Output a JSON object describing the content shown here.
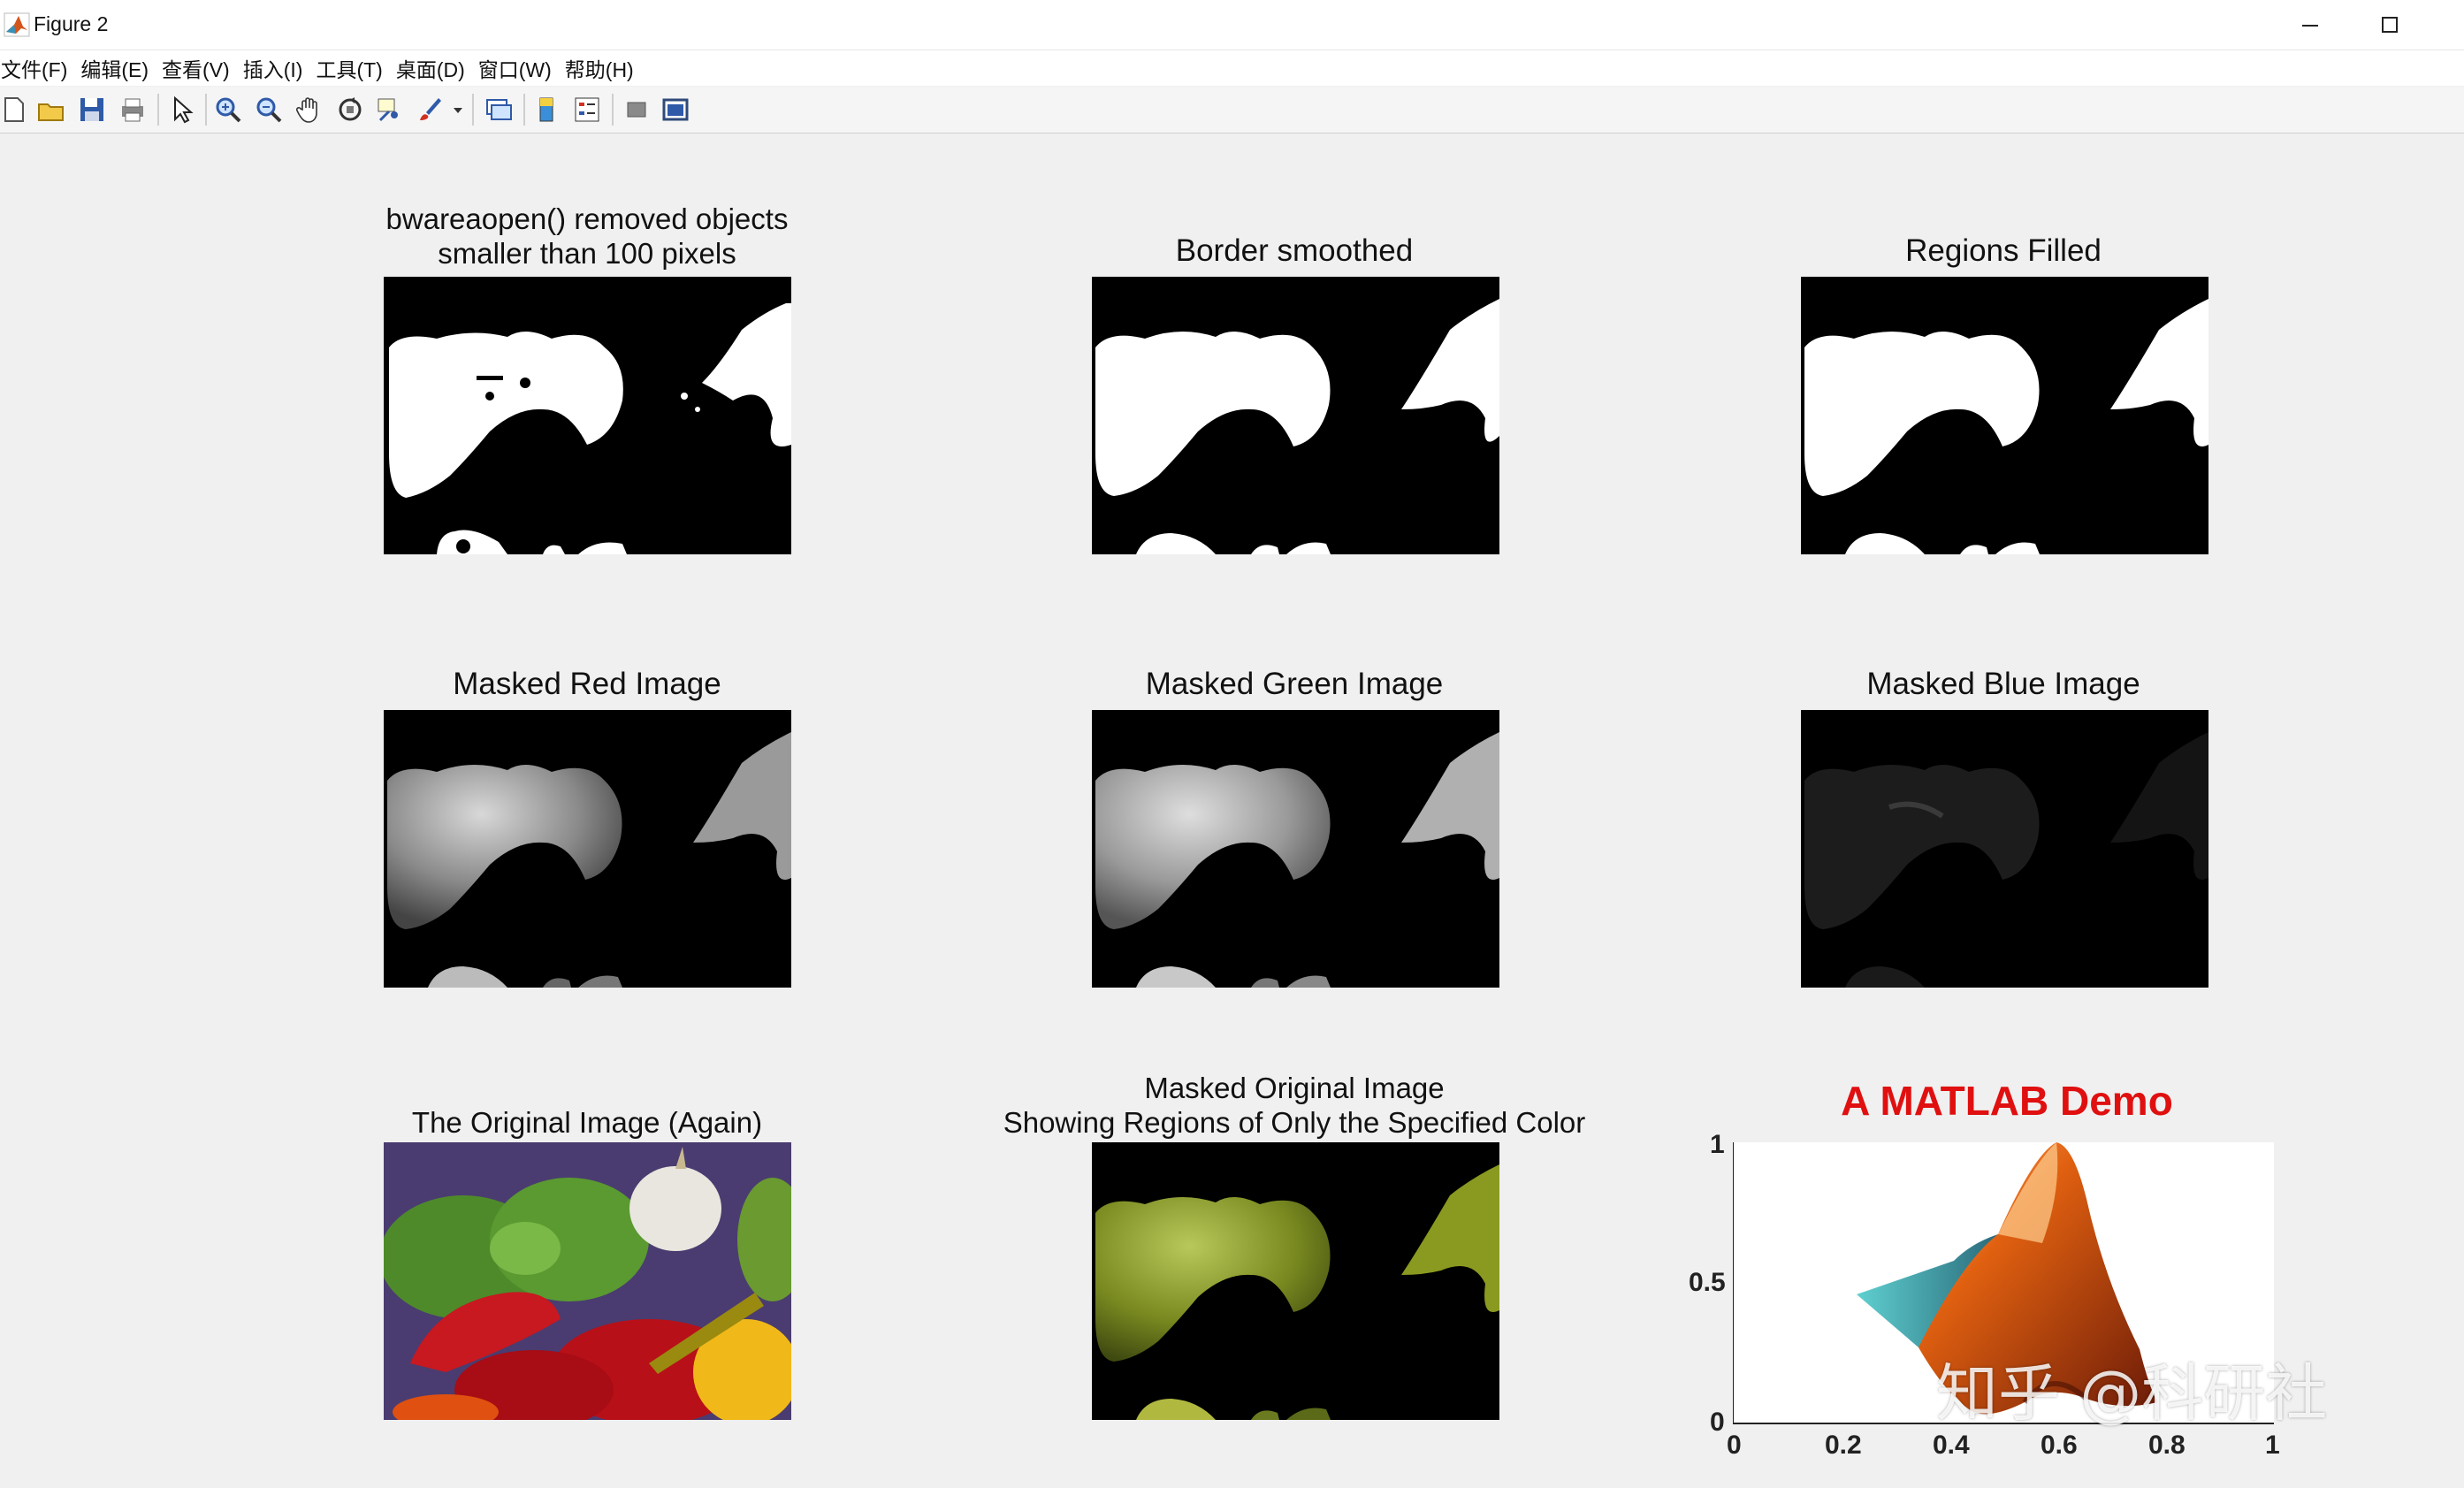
{
  "window": {
    "title": "Figure 2",
    "minimize_glyph": "—",
    "maximize_glyph": "☐"
  },
  "menu": [
    {
      "label": "文件(F)"
    },
    {
      "label": "编辑(E)"
    },
    {
      "label": "查看(V)"
    },
    {
      "label": "插入(I)"
    },
    {
      "label": "工具(T)"
    },
    {
      "label": "桌面(D)"
    },
    {
      "label": "窗口(W)"
    },
    {
      "label": "帮助(H)"
    }
  ],
  "toolbar": {
    "icons": [
      "new-figure-icon",
      "open-icon",
      "save-icon",
      "print-icon",
      "pointer-icon",
      "zoom-in-icon",
      "zoom-out-icon",
      "pan-hand-icon",
      "rotate-3d-icon",
      "data-cursor-icon",
      "brush-icon",
      "dropdown-arrow-icon",
      "link-plot-icon",
      "colorbar-icon",
      "legend-icon",
      "hide-plot-tools-icon",
      "show-plot-tools-icon"
    ]
  },
  "panels": {
    "p1": {
      "title_line1": "bwareaopen() removed objects",
      "title_line2": "smaller than 100 pixels"
    },
    "p2": {
      "title": "Border smoothed"
    },
    "p3": {
      "title": "Regions Filled"
    },
    "p4": {
      "title": "Masked Red Image"
    },
    "p5": {
      "title": "Masked Green Image"
    },
    "p6": {
      "title": "Masked Blue Image"
    },
    "p7": {
      "title": "The Original Image (Again)"
    },
    "p8": {
      "title_line1": "Masked Original Image",
      "title_line2": "Showing Regions of Only the Specified Color"
    },
    "p9": {
      "title": "A MATLAB Demo",
      "title_color": "#e01010"
    }
  },
  "chart_data": {
    "type": "surface",
    "title": "A MATLAB Demo",
    "xlim": [
      0,
      1
    ],
    "ylim": [
      0,
      1
    ],
    "x_ticks": [
      "0",
      "0.2",
      "0.4",
      "0.6",
      "0.8",
      "1"
    ],
    "y_ticks": [
      "0",
      "0.5",
      "1"
    ],
    "grid": false
  },
  "watermark": "知乎 @科研社"
}
